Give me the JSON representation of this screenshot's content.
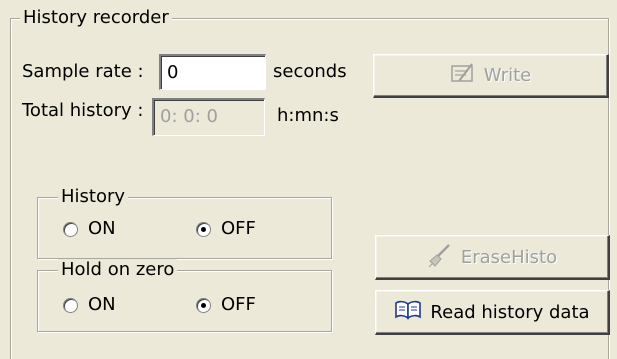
{
  "history_recorder": {
    "title": "History recorder",
    "sample_rate": {
      "label": "Sample rate :",
      "value": "0",
      "unit": "seconds"
    },
    "total_history": {
      "label": "Total history :",
      "value": "0: 0: 0",
      "unit": "h:mn:s"
    },
    "write_button": {
      "label": "Write",
      "icon": "write-icon",
      "enabled": false
    },
    "erase_button": {
      "label": "EraseHisto",
      "icon": "broom-icon",
      "enabled": false
    },
    "read_button": {
      "label": "Read history data",
      "icon": "open-book-icon",
      "enabled": true
    },
    "history_group": {
      "title": "History",
      "options": [
        {
          "label": "ON",
          "checked": false
        },
        {
          "label": "OFF",
          "checked": true
        }
      ]
    },
    "hold_on_zero_group": {
      "title": "Hold on zero",
      "options": [
        {
          "label": "ON",
          "checked": false
        },
        {
          "label": "OFF",
          "checked": true
        }
      ]
    }
  }
}
